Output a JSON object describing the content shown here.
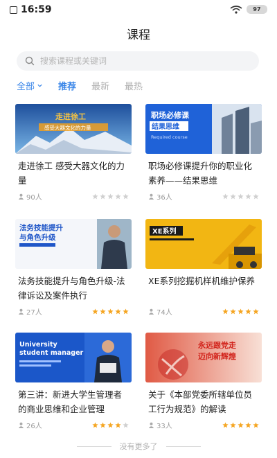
{
  "status_bar": {
    "time": "16:59",
    "battery": "97"
  },
  "header": {
    "title": "课程"
  },
  "search": {
    "placeholder": "搜索课程或关键词"
  },
  "filters": {
    "all_label": "全部",
    "tabs": [
      {
        "label": "推荐",
        "active": true
      },
      {
        "label": "最新",
        "active": false
      },
      {
        "label": "最热",
        "active": false
      }
    ]
  },
  "courses": [
    {
      "title": "走进徐工 感受大器文化的力量",
      "learners": "90人",
      "rating": 0,
      "thumb_title": "走进徐工",
      "thumb_sub": "感受大器文化的力量"
    },
    {
      "title": "职场必修课提升你的职业化素养——结果思维",
      "learners": "36人",
      "rating": 0,
      "thumb_title": "职场必修课",
      "thumb_title2": "结果思维",
      "thumb_sub": "Required course"
    },
    {
      "title": "法务技能提升与角色升级-法律诉讼及案件执行",
      "learners": "27人",
      "rating": 5,
      "thumb_title": "法务技能提升",
      "thumb_title2": "与角色升级"
    },
    {
      "title": "XE系列挖掘机样机维护保养",
      "learners": "74人",
      "rating": 5,
      "thumb_title": "XE系列"
    },
    {
      "title": "第三讲：新进大学生管理者的商业思维和企业管理",
      "learners": "26人",
      "rating": 4,
      "thumb_title": "University",
      "thumb_title2": "student manager"
    },
    {
      "title": "关于《本部党委所辖单位员工行为规范》的解读",
      "learners": "33人",
      "rating": 5,
      "thumb_title": "永远跟党走",
      "thumb_title2": "迈向新辉煌"
    }
  ],
  "footer": {
    "end_text": "没有更多了"
  },
  "colors": {
    "accent": "#3a86e8",
    "star_on": "#f5a623",
    "star_off": "#d0d0d0"
  }
}
